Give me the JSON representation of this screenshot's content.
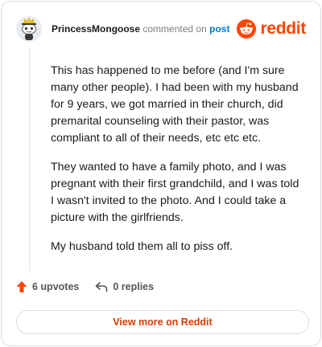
{
  "header": {
    "username": "PrincessMongoose",
    "action_text": "commented on",
    "post_link": "post",
    "brand": "reddit"
  },
  "comment": {
    "paragraphs": [
      "This has happened to me before (and I'm sure many other people). I had been with my husband for 9 years, we got married in their church, did premarital counseling with their pastor, was compliant to all of their needs, etc etc etc.",
      "They wanted to have a family photo, and I was pregnant with their first grandchild, and I was told I wasn't invited to the photo. And I could take a picture with the girlfriends.",
      "My husband told them all to piss off."
    ]
  },
  "actions": {
    "upvotes": "6 upvotes",
    "replies": "0 replies"
  },
  "footer": {
    "view_more": "View more on Reddit"
  },
  "colors": {
    "brand_orange": "#ff4500",
    "link_blue": "#0079d3",
    "button_text": "#d93a00"
  },
  "icons": [
    "avatar-snoo-icon",
    "reddit-logo-icon",
    "upvote-arrow-icon",
    "reply-arrow-icon"
  ]
}
